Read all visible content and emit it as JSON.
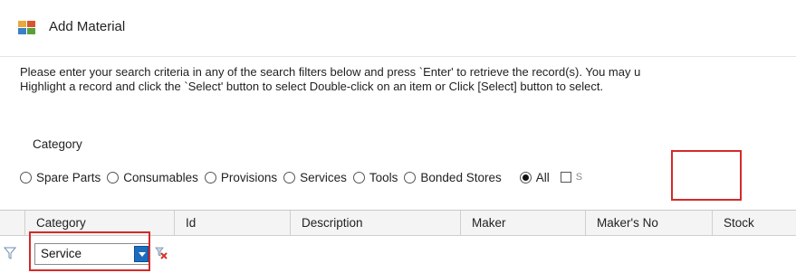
{
  "window": {
    "title": "Add Material",
    "icon": "material-app-icon"
  },
  "instructions": {
    "line1": "Please enter your search criteria in any of the search filters below and press `Enter' to retrieve the record(s). You may u",
    "line2": "Highlight a record and click the `Select' button to select Double-click on an item or Click [Select] button to select."
  },
  "category_group": {
    "label": "Category",
    "options": [
      "Spare Parts",
      "Consumables",
      "Provisions",
      "Services",
      "Tools",
      "Bonded Stores",
      "All"
    ],
    "selected": "All",
    "checkbox_label_partial": "S"
  },
  "grid": {
    "columns": [
      "Category",
      "Id",
      "Description",
      "Maker",
      "Maker's No",
      "Stock"
    ]
  },
  "filter_row": {
    "category_value": "Service",
    "filter_icon": "funnel-icon",
    "clear_icon": "clear-filter-icon"
  },
  "colors": {
    "highlight": "#d42a2a",
    "dropdown_button": "#1e6dbd"
  }
}
